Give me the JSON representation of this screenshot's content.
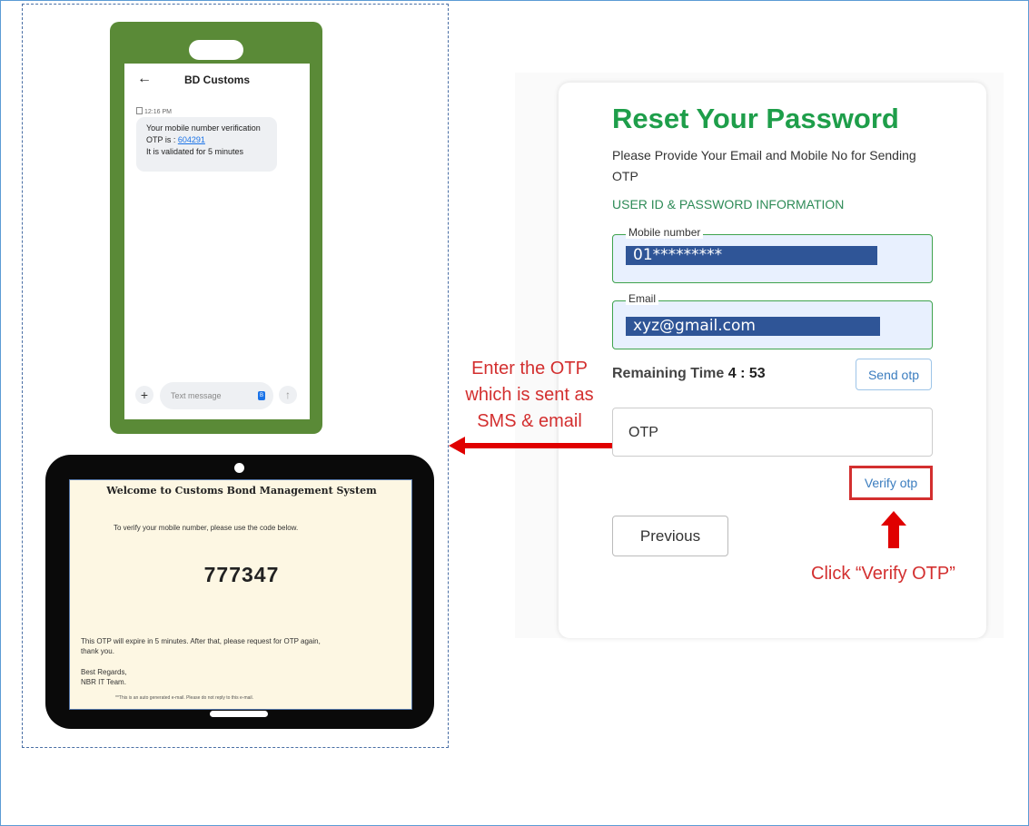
{
  "phone": {
    "contact": "BD Customs",
    "time": "12:16 PM",
    "message_line1": "Your mobile number verification",
    "message_otp_prefix": "OTP is : ",
    "message_otp": "604291",
    "message_line3": "It is validated for 5 minutes",
    "input_placeholder": "Text message",
    "plus": "+",
    "back": "←",
    "send": "↑",
    "badge": "B"
  },
  "email": {
    "title": "Welcome to Customs Bond Management System",
    "instruction": "To verify your mobile number, please use the code below.",
    "code": "777347",
    "expire": "This OTP will expire in 5 minutes. After that, please request for OTP again, thank you.",
    "regards": "Best Regards,",
    "team": "NBR IT Team.",
    "auto": "**This is an auto generated e-mail. Please do not reply to this e-mail."
  },
  "form": {
    "title": "Reset Your Password",
    "subtitle": "Please Provide Your Email and Mobile No for Sending OTP",
    "section": "USER ID & PASSWORD INFORMATION",
    "mobile_label": "Mobile number",
    "mobile_value": "01*********",
    "email_label": "Email",
    "email_value": "xyz@gmail.com",
    "remaining_label": "Remaining Time ",
    "remaining_value": "4 : 53",
    "send_otp": "Send otp",
    "otp_placeholder": "OTP",
    "verify_otp": "Verify otp",
    "previous": "Previous"
  },
  "annotations": {
    "enter_otp": "Enter the OTP which is sent as SMS & email",
    "click_verify": "Click “Verify OTP”"
  },
  "colors": {
    "accent_green": "#1e9e4a",
    "annotation_red": "#d32f2f",
    "highlight_blue": "#2f5597"
  }
}
